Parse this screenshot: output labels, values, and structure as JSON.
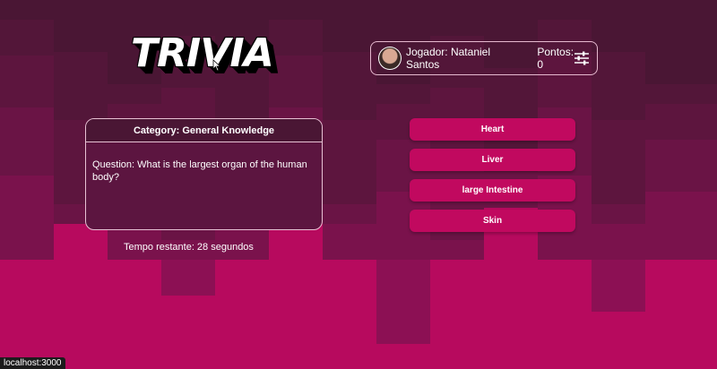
{
  "header": {
    "logo_text": "TRIVIA",
    "player_label": "Jogador: Nataniel Santos",
    "score_label": "Pontos: 0"
  },
  "question": {
    "category": "Category: General Knowledge",
    "text": "Question: What is the largest organ of the human body?"
  },
  "answers": [
    "Heart",
    "Liver",
    "large Intestine",
    "Skin"
  ],
  "timer_label": "Tempo restante: 28 segundos",
  "status_bar": {
    "url": "localhost:3000"
  },
  "colors": {
    "background": "#b70a5e",
    "answer_button": "#c1095f",
    "card_background": "#5c1540",
    "card_header": "#4a1634"
  },
  "icons": [
    "cursor-icon",
    "avatar",
    "settings-sliders-icon"
  ]
}
